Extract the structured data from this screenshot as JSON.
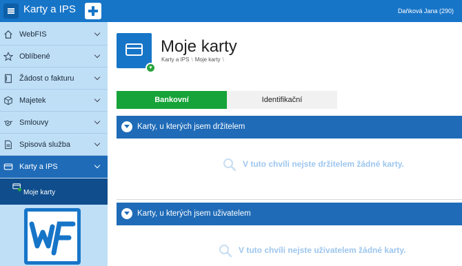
{
  "topbar": {
    "app_title": "Karty a IPS",
    "user_name": "Daňková Jana (290)",
    "menu_icon": "hamburger-icon",
    "add_icon": "plus-icon"
  },
  "sidebar": {
    "items": [
      {
        "label": "WebFIS",
        "icon": "home-icon"
      },
      {
        "label": "Oblíbené",
        "icon": "star-icon"
      },
      {
        "label": "Žádost o fakturu",
        "icon": "document-icon"
      },
      {
        "label": "Majetek",
        "icon": "box-icon"
      },
      {
        "label": "Smlouvy",
        "icon": "handshake-icon"
      },
      {
        "label": "Spisová služba",
        "icon": "file-icon"
      },
      {
        "label": "Karty a IPS",
        "icon": "credit-card-icon"
      }
    ],
    "sub_item": {
      "label": "Moje karty",
      "icon": "card-user-icon"
    },
    "logo_icon": "wf-logo-icon"
  },
  "page": {
    "title": "Moje karty",
    "breadcrumb": [
      "Karty a IPS",
      "Moje karty"
    ],
    "breadcrumb_separator": "\\",
    "header_icon": "credit-card-icon",
    "badge_icon": "heart-icon"
  },
  "tabs": [
    {
      "label": "Bankovní",
      "active": true
    },
    {
      "label": "Identifikační",
      "active": false
    }
  ],
  "sections": [
    {
      "title": "Karty, u kterých jsem držitelem",
      "empty_text": "V tuto chvíli nejste držitelem žádné karty."
    },
    {
      "title": "Karty, u kterých jsem uživatelem",
      "empty_text": "V tuto chvíli nejste uživatelem žádné karty."
    }
  ],
  "colors": {
    "topbar": "#1775c8",
    "sidebar": "#bfdff6",
    "active_nav": "#1f6bb8",
    "active_sub": "#0f4d8c",
    "tab_active": "#16a339",
    "empty_text": "#9dc6ee"
  }
}
